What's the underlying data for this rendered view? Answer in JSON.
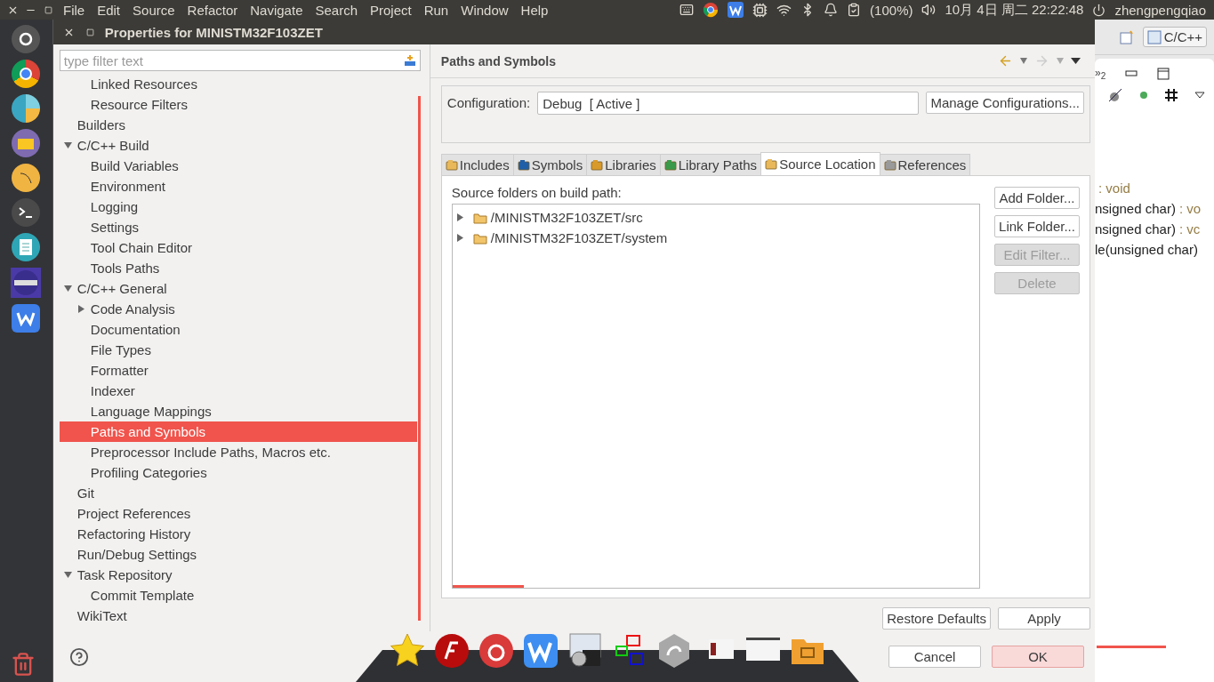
{
  "top_bar": {
    "menus": [
      "File",
      "Edit",
      "Source",
      "Refactor",
      "Navigate",
      "Search",
      "Project",
      "Run",
      "Window",
      "Help"
    ],
    "battery": "(100%)",
    "clock": "10月 4日 周二 22:22:48",
    "user": "zhengpengqiao"
  },
  "dialog": {
    "title": "Properties for MINISTM32F103ZET",
    "filter": {
      "placeholder": "type filter text"
    },
    "tree": [
      {
        "children": [
          {
            "label": "Linked Resources",
            "selected": false
          },
          {
            "label": "Resource Filters",
            "selected": false
          }
        ]
      },
      {
        "label": "Builders",
        "selected": false
      },
      {
        "label": "C/C++ Build",
        "selected": false,
        "expanded": true,
        "children": [
          {
            "label": "Build Variables",
            "selected": false
          },
          {
            "label": "Environment",
            "selected": false
          },
          {
            "label": "Logging",
            "selected": false
          },
          {
            "label": "Settings",
            "selected": false
          },
          {
            "label": "Tool Chain Editor",
            "selected": false
          },
          {
            "label": "Tools Paths",
            "selected": false
          }
        ]
      },
      {
        "label": "C/C++ General",
        "selected": false,
        "expanded": true,
        "children": [
          {
            "label": "Code Analysis",
            "selected": false,
            "expanded": false
          },
          {
            "label": "Documentation",
            "selected": false
          },
          {
            "label": "File Types",
            "selected": false
          },
          {
            "label": "Formatter",
            "selected": false
          },
          {
            "label": "Indexer",
            "selected": false
          },
          {
            "label": "Language Mappings",
            "selected": false
          },
          {
            "label": "Paths and Symbols",
            "selected": true
          },
          {
            "label": "Preprocessor Include Paths, Macros etc.",
            "selected": false
          },
          {
            "label": "Profiling Categories",
            "selected": false
          }
        ]
      },
      {
        "label": "Git",
        "selected": false
      },
      {
        "label": "Project References",
        "selected": false
      },
      {
        "label": "Refactoring History",
        "selected": false
      },
      {
        "label": "Run/Debug Settings",
        "selected": false
      },
      {
        "label": "Task Repository",
        "selected": false,
        "expanded": true,
        "children": [
          {
            "label": "Commit Template",
            "selected": false
          }
        ]
      },
      {
        "label": "WikiText",
        "selected": false
      }
    ],
    "page_title": "Paths and Symbols",
    "configuration": {
      "label": "Configuration:",
      "value": "Debug  [ Active ]",
      "manage_button": "Manage Configurations..."
    },
    "tabs": [
      {
        "label": "Includes",
        "selected": false
      },
      {
        "label": "Symbols",
        "selected": false
      },
      {
        "label": "Libraries",
        "selected": false
      },
      {
        "label": "Library Paths",
        "selected": false
      },
      {
        "label": "Source Location",
        "selected": true
      },
      {
        "label": "References",
        "selected": false
      }
    ],
    "source_label": "Source folders on build path:",
    "folders": [
      {
        "label": "/MINISTM32F103ZET/src",
        "expanded": false
      },
      {
        "label": "/MINISTM32F103ZET/system",
        "expanded": false
      }
    ],
    "side_buttons": [
      {
        "label": "Add Folder...",
        "disabled": false
      },
      {
        "label": "Link Folder...",
        "disabled": false
      },
      {
        "label": "Edit Filter...",
        "disabled": true
      },
      {
        "label": "Delete",
        "disabled": true
      }
    ],
    "page_buttons": [
      "Restore Defaults",
      "Apply"
    ],
    "dialog_buttons": [
      {
        "label": "Cancel",
        "default": false
      },
      {
        "label": "OK",
        "default": true
      }
    ]
  },
  "ide": {
    "perspective": "C/C++",
    "view_tabs": "»$_{2}$",
    "outline": [
      {
        "type": ": void"
      },
      {
        "signature": "nsigned char)",
        "type": ": vo"
      },
      {
        "signature": "nsigned char)",
        "type": ": vc"
      },
      {
        "signature": "le(unsigned char)"
      }
    ]
  }
}
